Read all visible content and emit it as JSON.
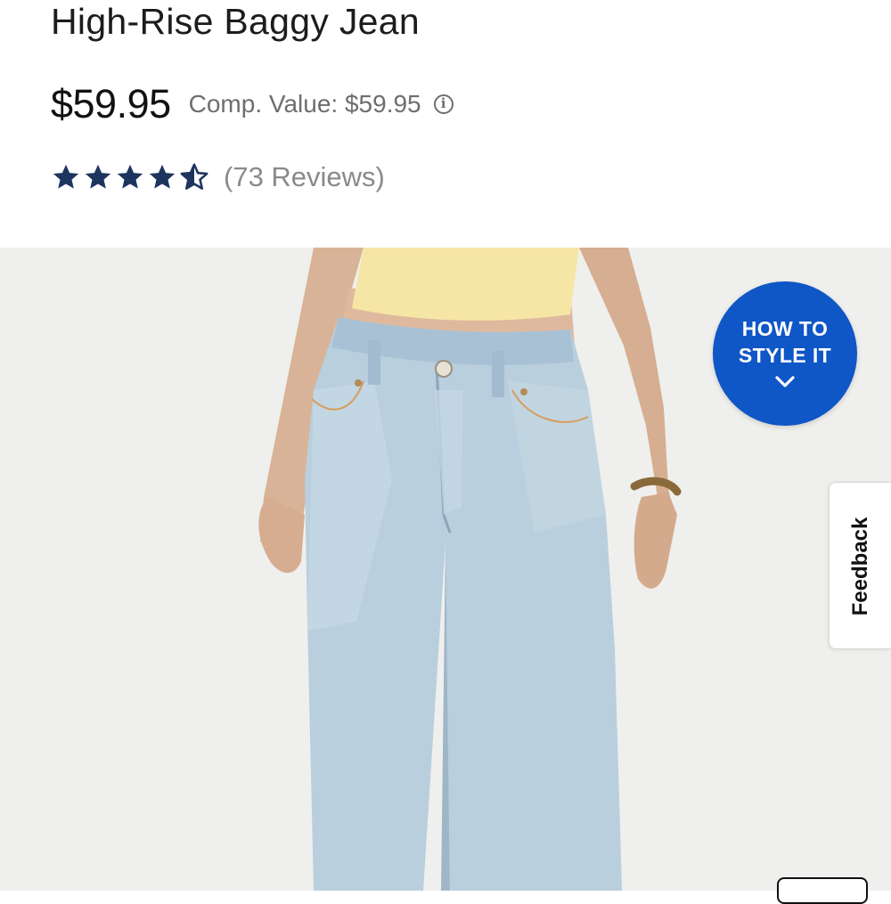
{
  "product": {
    "title": "High-Rise Baggy Jean",
    "price": "$59.95",
    "comp_value": "Comp. Value: $59.95",
    "rating": 4.5,
    "reviews": "(73 Reviews)",
    "info_icon": "info-icon"
  },
  "buttons": {
    "style_line1": "HOW TO",
    "style_line2": "STYLE IT",
    "style_icon": "chevron-down-icon",
    "feedback": "Feedback"
  },
  "colors": {
    "accent_blue": "#0f56c6",
    "star_navy": "#1d355e",
    "muted_text": "#6e6e6e"
  }
}
